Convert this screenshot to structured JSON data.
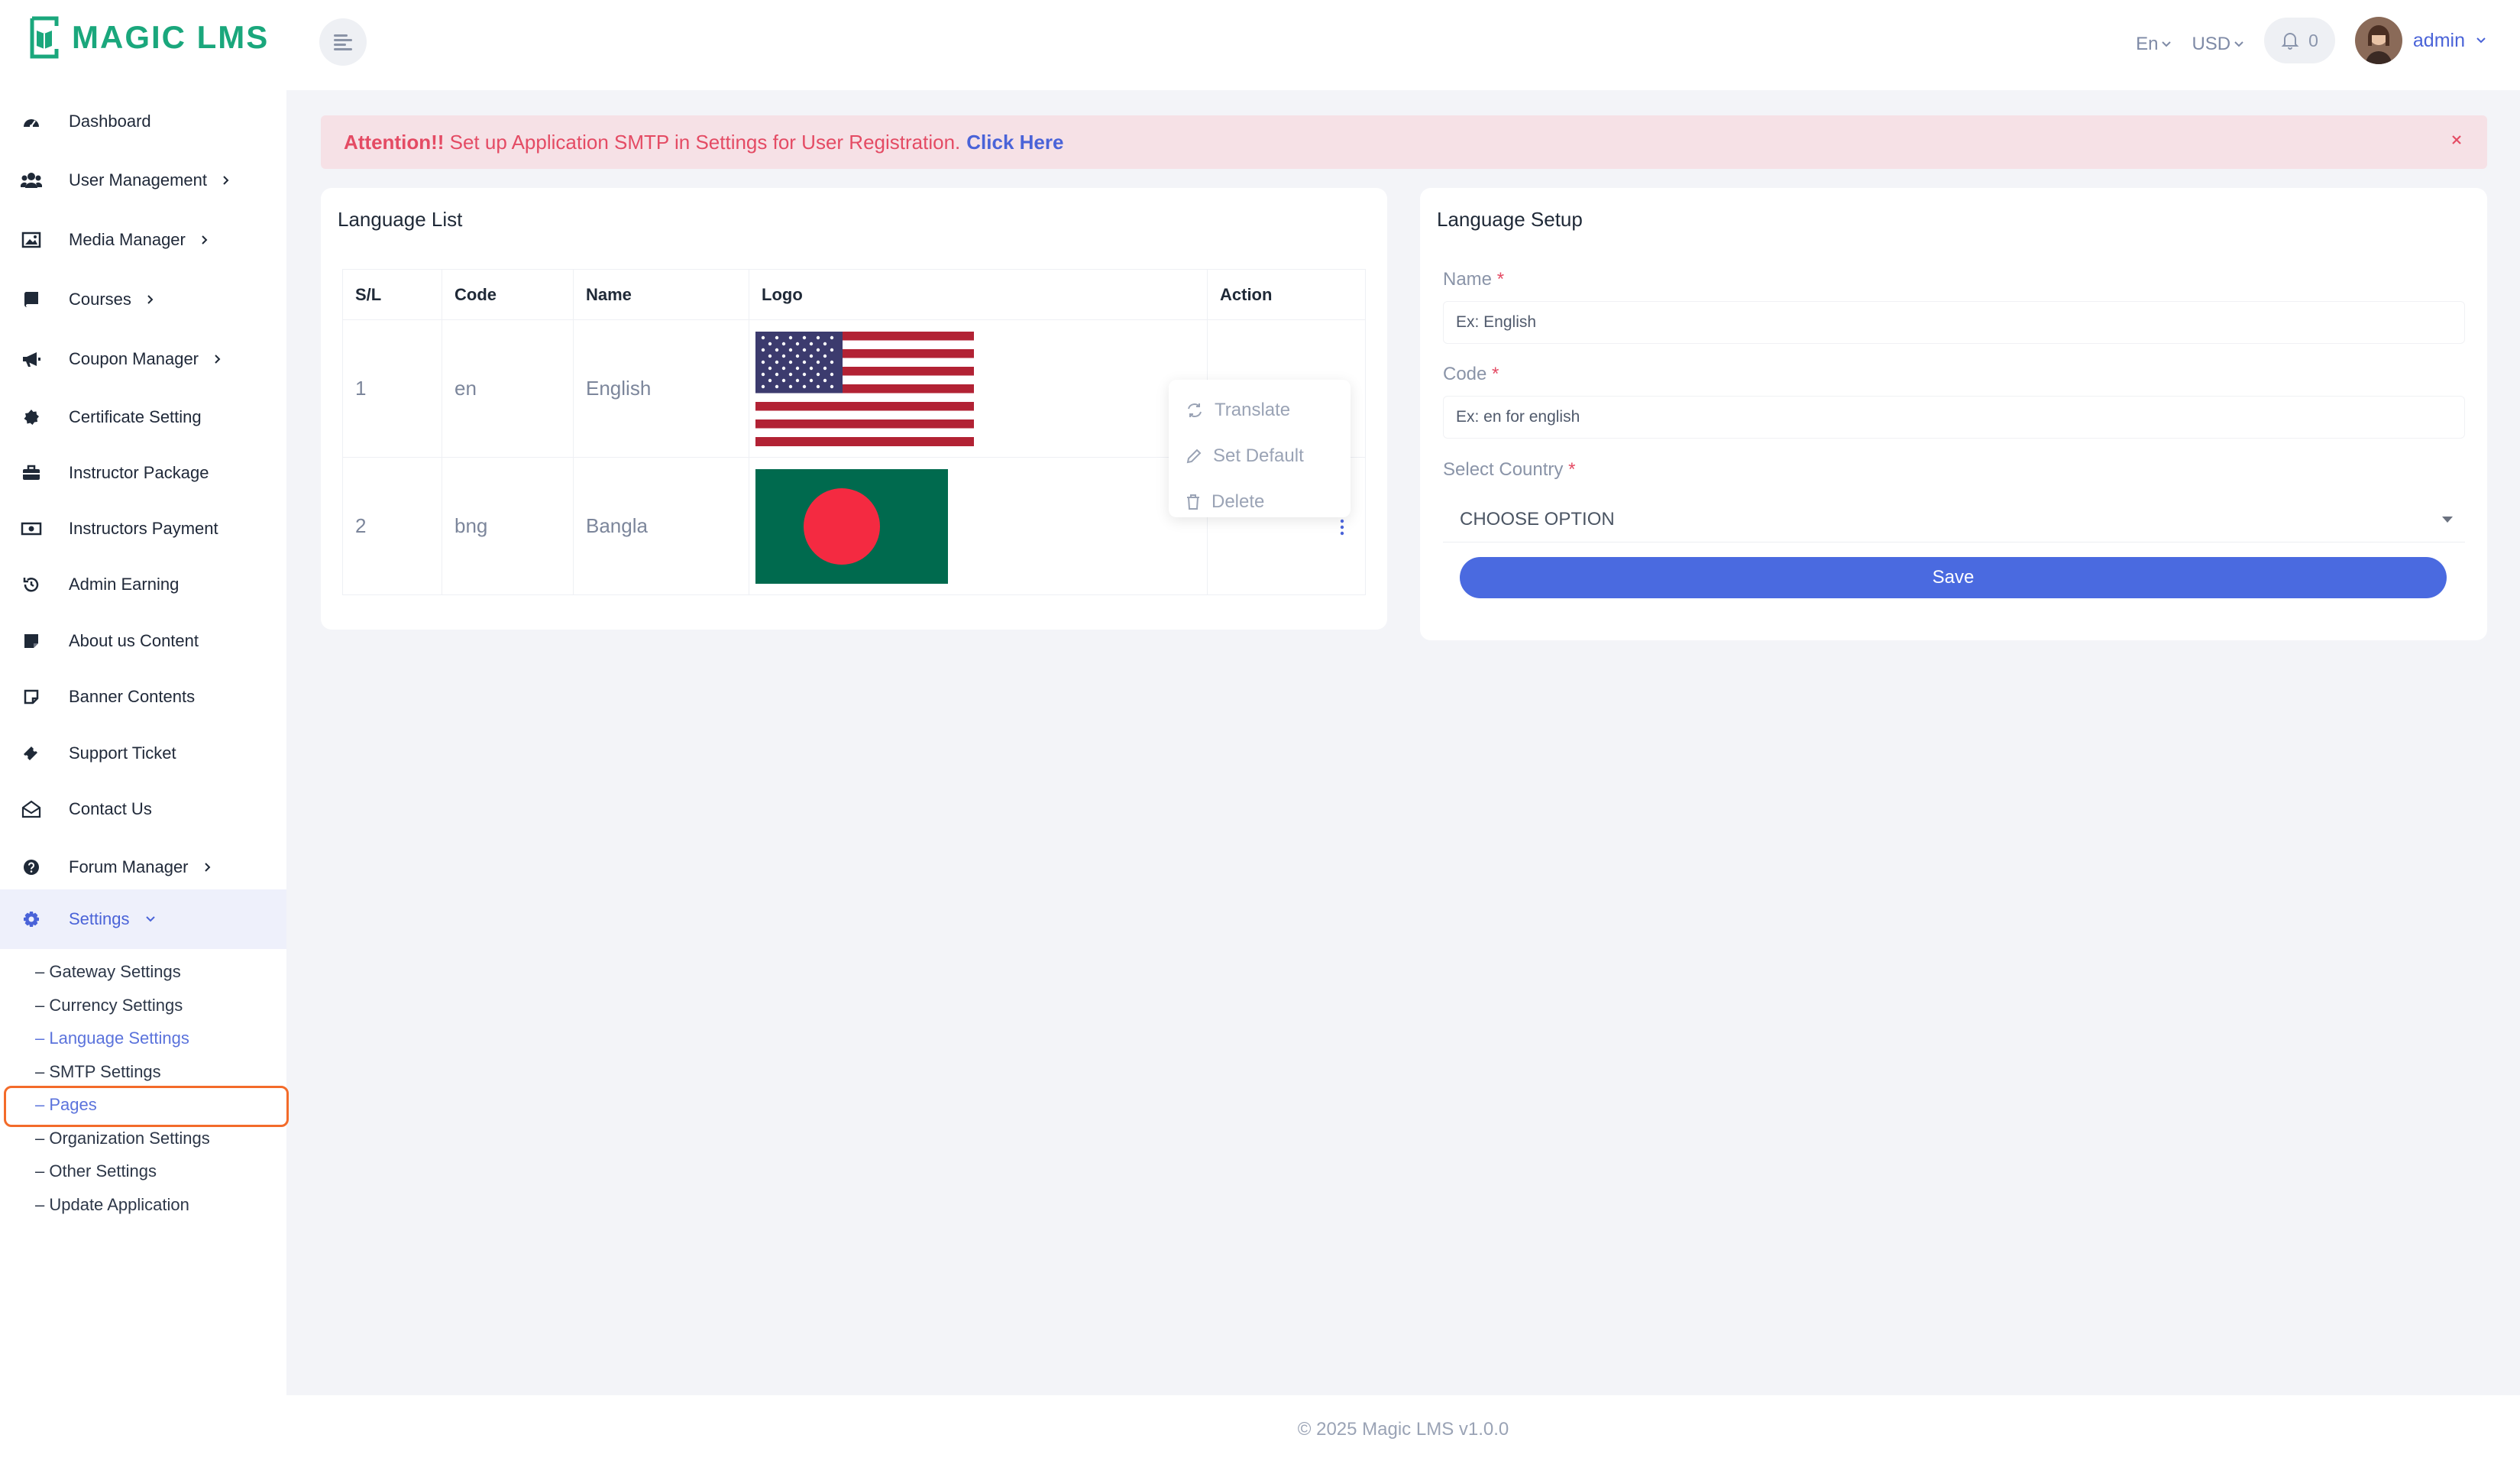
{
  "app": {
    "logo_text": "MAGIC LMS"
  },
  "header": {
    "language": "En",
    "currency": "USD",
    "notification_count": "0",
    "username": "admin"
  },
  "sidebar": {
    "items": [
      {
        "label": "Dashboard",
        "icon": "dashboard-icon"
      },
      {
        "label": "User Management",
        "icon": "users-icon",
        "has_children": true
      },
      {
        "label": "Media Manager",
        "icon": "image-icon",
        "has_children": true
      },
      {
        "label": "Courses",
        "icon": "book-icon",
        "has_children": true
      },
      {
        "label": "Coupon Manager",
        "icon": "megaphone-icon",
        "has_children": true
      },
      {
        "label": "Certificate Setting",
        "icon": "certificate-icon"
      },
      {
        "label": "Instructor Package",
        "icon": "briefcase-icon"
      },
      {
        "label": "Instructors Payment",
        "icon": "money-icon"
      },
      {
        "label": "Admin Earning",
        "icon": "history-icon"
      },
      {
        "label": "About us Content",
        "icon": "note-icon"
      },
      {
        "label": "Banner Contents",
        "icon": "sticky-note-icon"
      },
      {
        "label": "Support Ticket",
        "icon": "ticket-icon"
      },
      {
        "label": "Contact Us",
        "icon": "envelope-open-icon"
      },
      {
        "label": "Forum Manager",
        "icon": "question-circle-icon",
        "has_children": true
      },
      {
        "label": "Settings",
        "icon": "gear-icon",
        "expanded": true
      }
    ],
    "settings_subitems": [
      "– Gateway Settings",
      "– Currency Settings",
      "– Language Settings",
      "– SMTP Settings",
      "– Pages",
      "– Organization Settings",
      "– Other Settings",
      "– Update Application"
    ]
  },
  "alert": {
    "prefix": "Attention!!",
    "message": " Set up Application SMTP in Settings for User Registration.",
    "link": "Click Here"
  },
  "language_list": {
    "title": "Language List",
    "columns": [
      "S/L",
      "Code",
      "Name",
      "Logo",
      "Action"
    ],
    "rows": [
      {
        "sl": "1",
        "code": "en",
        "name": "English",
        "flag": "us-flag-icon"
      },
      {
        "sl": "2",
        "code": "bng",
        "name": "Bangla",
        "flag": "bangladesh-flag-icon"
      }
    ],
    "action_menu": [
      "Translate",
      "Set Default",
      "Delete"
    ]
  },
  "language_setup": {
    "title": "Language Setup",
    "name_label": "Name",
    "name_placeholder": "Ex: English",
    "code_label": "Code",
    "code_placeholder": "Ex: en for english",
    "country_label": "Select Country",
    "country_value": "CHOOSE OPTION",
    "save_label": "Save",
    "required_mark": "*"
  },
  "footer": {
    "text": "© 2025 Magic LMS v1.0.0"
  },
  "colors": {
    "brand_green": "#1aa77c",
    "accent_blue": "#4a6ae0",
    "alert_red": "#e44b64",
    "alert_bg": "#f6e1e6",
    "highlight_orange": "#f36b2a"
  }
}
